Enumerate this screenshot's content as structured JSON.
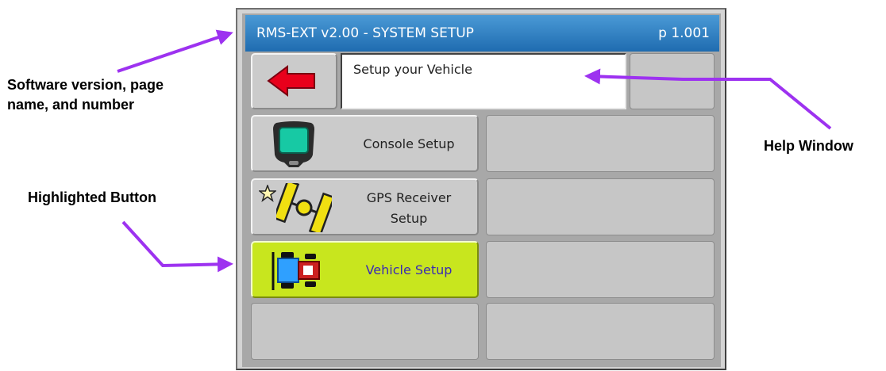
{
  "annotations": {
    "software_version": [
      "Software version, page",
      "name, and number"
    ],
    "help_window": "Help Window",
    "highlighted_button": "Highlighted Button"
  },
  "console": {
    "title": "RMS-EXT v2.00 - SYSTEM SETUP",
    "page_number": "p 1.001",
    "help_text": "Setup your Vehicle",
    "buttons": [
      {
        "label": [
          "Console Setup"
        ],
        "icon": "console-icon",
        "highlighted": false
      },
      {
        "label": [
          "GPS Receiver",
          "Setup"
        ],
        "icon": "gps-satellite-icon",
        "highlighted": false
      },
      {
        "label": [
          "Vehicle Setup"
        ],
        "icon": "tractor-icon",
        "highlighted": true
      }
    ],
    "colors": {
      "title_bar": "#2a7bc0",
      "highlight": "#c8e61e",
      "back_arrow": "#e8001b",
      "callout_arrow": "#9d32f0"
    }
  }
}
